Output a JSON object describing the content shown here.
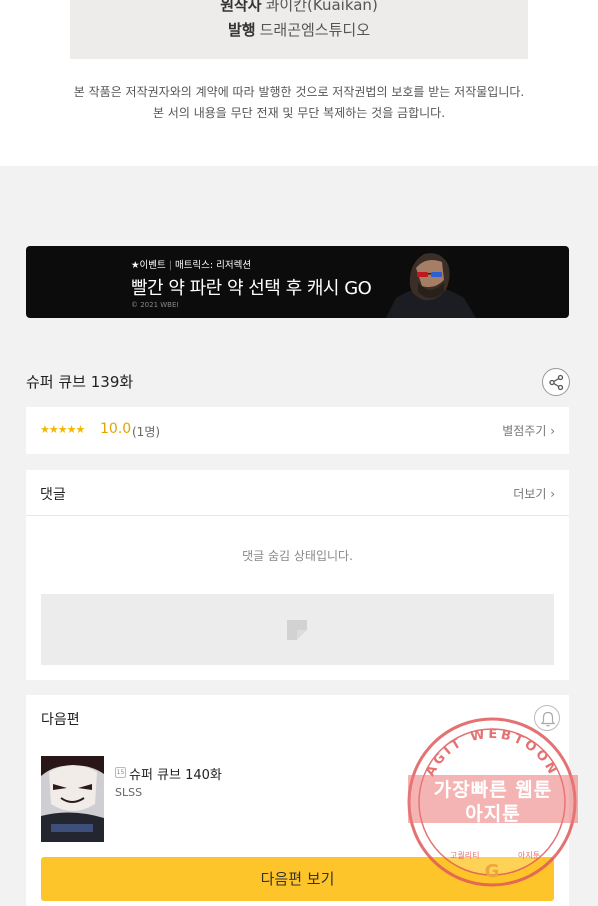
{
  "credits": {
    "original_label": "원작사",
    "original_value": "콰이칸(Kuaikan)",
    "publisher_label": "발행",
    "publisher_value": "드래곤엠스튜디오"
  },
  "notice": {
    "line1": "본 작품은 저작권자와의 계약에 따라 발행한 것으로 저작권법의 보호를 받는 저작물입니다.",
    "line2": "본 서의 내용을 무단 전재 및 무단 복제하는 것을 금합니다."
  },
  "banner": {
    "tag": "★이벤트",
    "subtitle": "매트릭스: 리저렉션",
    "headline": "빨간 약 파란 약 선택 후 캐시 GO",
    "copyright": "© 2021 WBEI"
  },
  "episode": {
    "title": "슈퍼 큐브 139화"
  },
  "rating": {
    "stars": "★★★★★",
    "score": "10.0",
    "count": "(1명)",
    "rate_link": "별점주기 ›"
  },
  "comments": {
    "title": "댓글",
    "more_link": "더보기 ›",
    "hidden_message": "댓글 숨김 상태입니다."
  },
  "next_episode": {
    "section_title": "다음편",
    "age_badge": "15",
    "episode_title": "슈퍼 큐브 140화",
    "author": "SLSS",
    "button_label": "다음편 보기"
  },
  "watermark": {
    "ring_text": "AGIT WEBTOON",
    "line1": "가장빠른 웹툰",
    "line2": "아지툰",
    "bottom_left": "고퀄리티",
    "bottom_right": "아지툰"
  },
  "colors": {
    "accent_yellow": "#fdc52a",
    "star_gold": "#f1b800",
    "stamp_red": "#e05a5a"
  },
  "icons": {
    "share": "share-icon",
    "bell": "bell-icon",
    "ad_placeholder": "ad-placeholder-icon"
  }
}
